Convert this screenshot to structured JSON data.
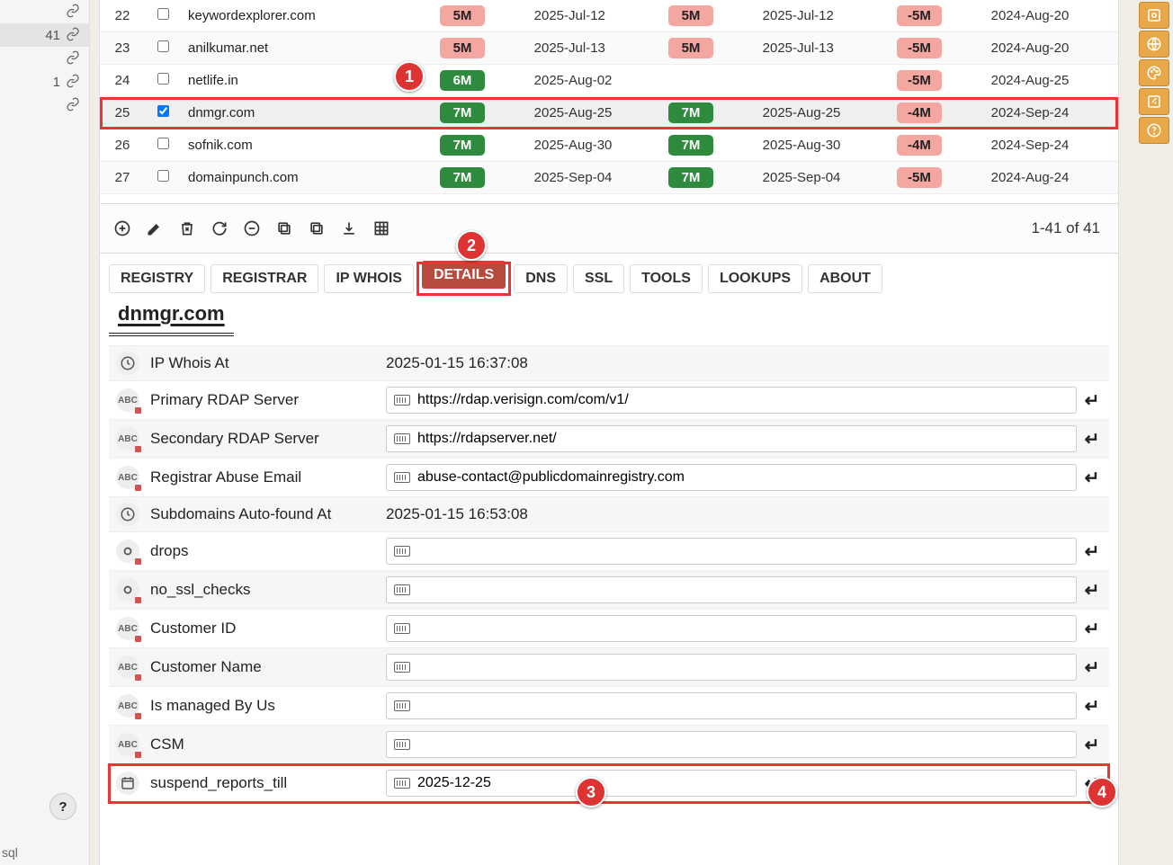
{
  "left_panel": {
    "count": "41",
    "secondary": "1"
  },
  "table": {
    "rows": [
      {
        "idx": "22",
        "checked": false,
        "domain": "keywordexplorer.com",
        "b1": "5M",
        "b1c": "pink",
        "d1": "2025-Jul-12",
        "b2": "5M",
        "b2c": "pink",
        "d2": "2025-Jul-12",
        "b3": "-5M",
        "b3c": "pink",
        "d3": "2024-Aug-20"
      },
      {
        "idx": "23",
        "checked": false,
        "domain": "anilkumar.net",
        "b1": "5M",
        "b1c": "pink",
        "d1": "2025-Jul-13",
        "b2": "5M",
        "b2c": "pink",
        "d2": "2025-Jul-13",
        "b3": "-5M",
        "b3c": "pink",
        "d3": "2024-Aug-20"
      },
      {
        "idx": "24",
        "checked": false,
        "domain": "netlife.in",
        "b1": "6M",
        "b1c": "green",
        "d1": "2025-Aug-02",
        "b2": "",
        "b2c": "",
        "d2": "",
        "b3": "-5M",
        "b3c": "pink",
        "d3": "2024-Aug-25"
      },
      {
        "idx": "25",
        "checked": true,
        "domain": "dnmgr.com",
        "b1": "7M",
        "b1c": "green",
        "d1": "2025-Aug-25",
        "b2": "7M",
        "b2c": "green",
        "d2": "2025-Aug-25",
        "b3": "-4M",
        "b3c": "pink",
        "d3": "2024-Sep-24",
        "selected": true
      },
      {
        "idx": "26",
        "checked": false,
        "domain": "sofnik.com",
        "b1": "7M",
        "b1c": "green",
        "d1": "2025-Aug-30",
        "b2": "7M",
        "b2c": "green",
        "d2": "2025-Aug-30",
        "b3": "-4M",
        "b3c": "pink",
        "d3": "2024-Sep-24"
      },
      {
        "idx": "27",
        "checked": false,
        "domain": "domainpunch.com",
        "b1": "7M",
        "b1c": "green",
        "d1": "2025-Sep-04",
        "b2": "7M",
        "b2c": "green",
        "d2": "2025-Sep-04",
        "b3": "-5M",
        "b3c": "pink",
        "d3": "2024-Aug-24"
      }
    ]
  },
  "pager": "1-41 of 41",
  "tabs": [
    "REGISTRY",
    "REGISTRAR",
    "IP WHOIS",
    "DETAILS",
    "DNS",
    "SSL",
    "TOOLS",
    "LOOKUPS",
    "ABOUT"
  ],
  "active_tab": "DETAILS",
  "domain_title": "dnmgr.com",
  "details": [
    {
      "icon": "clock",
      "label": "IP Whois At",
      "value": "2025-01-15 16:37:08",
      "editable": false
    },
    {
      "icon": "abc",
      "label": "Primary RDAP Server",
      "value": "https://rdap.verisign.com/com/v1/",
      "editable": true
    },
    {
      "icon": "abc",
      "label": "Secondary RDAP Server",
      "value": "https://rdapserver.net/",
      "editable": true
    },
    {
      "icon": "abc",
      "label": "Registrar Abuse Email",
      "value": "abuse-contact@publicdomainregistry.com",
      "editable": true
    },
    {
      "icon": "clock",
      "label": "Subdomains Auto-found At",
      "value": "2025-01-15 16:53:08",
      "editable": false
    },
    {
      "icon": "rec",
      "label": "drops",
      "value": "",
      "editable": true
    },
    {
      "icon": "rec",
      "label": "no_ssl_checks",
      "value": "",
      "editable": true
    },
    {
      "icon": "abc",
      "label": "Customer ID",
      "value": "",
      "editable": true
    },
    {
      "icon": "abc",
      "label": "Customer Name",
      "value": "",
      "editable": true
    },
    {
      "icon": "abc",
      "label": "Is managed By Us",
      "value": "",
      "editable": true
    },
    {
      "icon": "abc",
      "label": "CSM",
      "value": "",
      "editable": true
    },
    {
      "icon": "cal",
      "label": "suspend_reports_till",
      "value": "2025-12-25",
      "editable": true,
      "highlight": true
    }
  ],
  "callouts": {
    "c1": "1",
    "c2": "2",
    "c3": "3",
    "c4": "4"
  },
  "footer": "sql"
}
